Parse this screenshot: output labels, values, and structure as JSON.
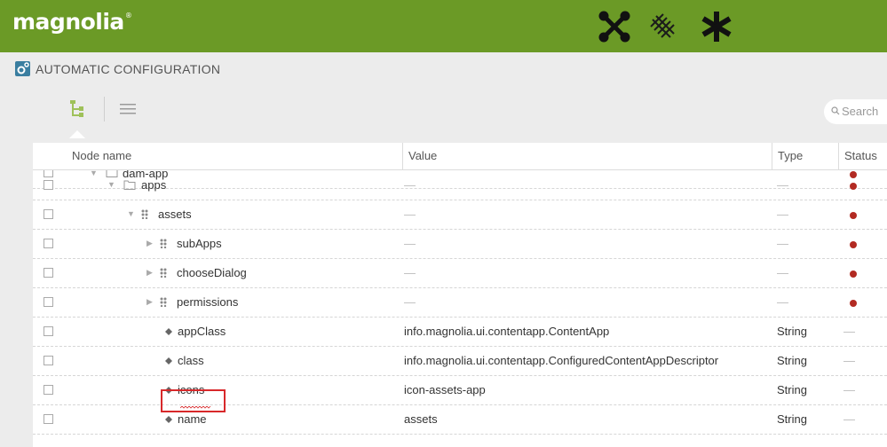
{
  "header": {
    "logo": "magnolia",
    "logo_mark": "®",
    "icons": [
      "apps-launcher-icon",
      "pulse-icon",
      "favorites-icon"
    ]
  },
  "app": {
    "title": "AUTOMATIC CONFIGURATION",
    "icon": "config-app-icon"
  },
  "toolbar": {
    "search_placeholder": "Search",
    "views": [
      "tree-view-icon",
      "list-view-icon"
    ]
  },
  "grid": {
    "columns": {
      "name": "Node name",
      "value": "Value",
      "type": "Type",
      "status": "Status"
    },
    "partial_row": {
      "name": "dam-app"
    },
    "rows": [
      {
        "name": "apps",
        "kind": "folder",
        "value": "—",
        "type": "—",
        "status": "red-dot"
      },
      {
        "name": "assets",
        "kind": "content-node",
        "value": "—",
        "type": "—",
        "status": "red-dot"
      },
      {
        "name": "subApps",
        "kind": "content-node",
        "value": "—",
        "type": "—",
        "status": "red-dot"
      },
      {
        "name": "chooseDialog",
        "kind": "content-node",
        "value": "—",
        "type": "—",
        "status": "red-dot"
      },
      {
        "name": "permissions",
        "kind": "content-node",
        "value": "—",
        "type": "—",
        "status": "red-dot"
      },
      {
        "name": "appClass",
        "kind": "property",
        "value": "info.magnolia.ui.contentapp.ContentApp",
        "type": "String",
        "status": "—"
      },
      {
        "name": "class",
        "kind": "property",
        "value": "info.magnolia.ui.contentapp.ConfiguredContentAppDescriptor",
        "type": "String",
        "status": "—"
      },
      {
        "name": "icons",
        "kind": "property",
        "value": "icon-assets-app",
        "type": "String",
        "status": "—"
      },
      {
        "name": "name",
        "kind": "property",
        "value": "assets",
        "type": "String",
        "status": "—"
      }
    ]
  },
  "colors": {
    "header_green": "#6b9a26",
    "status_red": "#b22a22",
    "highlight_red": "#d8282a"
  }
}
